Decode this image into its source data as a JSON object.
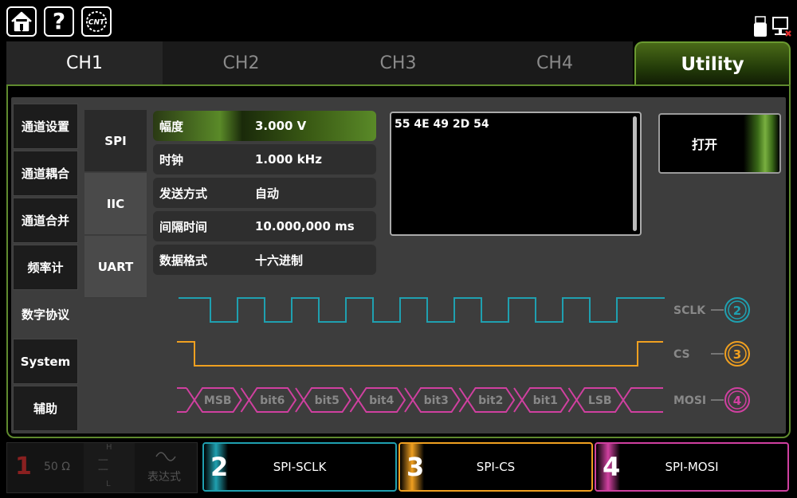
{
  "header": {
    "icons": [
      "home-icon",
      "help-icon",
      "cnt-logo-icon",
      "usb-icon",
      "network-disconnected-icon"
    ],
    "logo_text": "CNT"
  },
  "tabs": [
    {
      "label": "CH1",
      "active": true
    },
    {
      "label": "CH2",
      "active": false
    },
    {
      "label": "CH3",
      "active": false
    },
    {
      "label": "CH4",
      "active": false
    },
    {
      "label": "Utility",
      "active": false,
      "highlight": true
    }
  ],
  "sidebar": {
    "items": [
      {
        "label": "通道设置"
      },
      {
        "label": "通道耦合"
      },
      {
        "label": "通道合并"
      },
      {
        "label": "频率计"
      },
      {
        "label": "数字协议",
        "active": true
      },
      {
        "label": "System"
      },
      {
        "label": "辅助"
      }
    ]
  },
  "protocols": [
    {
      "label": "SPI",
      "active": true
    },
    {
      "label": "IIC"
    },
    {
      "label": "UART"
    }
  ],
  "params": [
    {
      "label": "幅度",
      "value": "3.000 V",
      "active": true
    },
    {
      "label": "时钟",
      "value": "1.000 kHz"
    },
    {
      "label": "发送方式",
      "value": "自动"
    },
    {
      "label": "间隔时间",
      "value": "10.000,000 ms"
    },
    {
      "label": "数据格式",
      "value": "十六进制"
    }
  ],
  "data_box": {
    "text": "55 4E 49 2D 54"
  },
  "open_button": {
    "label": "打开"
  },
  "waveform": {
    "signals": [
      {
        "name": "SCLK",
        "channel": "2",
        "color": "#1fa0b0"
      },
      {
        "name": "CS",
        "channel": "3",
        "color": "#f0a020"
      },
      {
        "name": "MOSI",
        "channel": "4",
        "color": "#d040a0"
      }
    ],
    "bits": [
      "MSB",
      "bit6",
      "bit5",
      "bit4",
      "bit3",
      "bit2",
      "bit1",
      "LSB"
    ]
  },
  "bottom": {
    "ch1": {
      "num": "1",
      "impedance": "50 Ω",
      "h": "H",
      "l": "L",
      "dashes": "----",
      "mode": "表达式"
    },
    "channels": [
      {
        "num": "2",
        "label": "SPI-SCLK",
        "color": "#1fa0b0"
      },
      {
        "num": "3",
        "label": "SPI-CS",
        "color": "#f0a020"
      },
      {
        "num": "4",
        "label": "SPI-MOSI",
        "color": "#d040a0"
      }
    ]
  },
  "colors": {
    "accent": "#5f8a2e",
    "sclk": "#1fa0b0",
    "cs": "#f0a020",
    "mosi": "#d040a0"
  }
}
